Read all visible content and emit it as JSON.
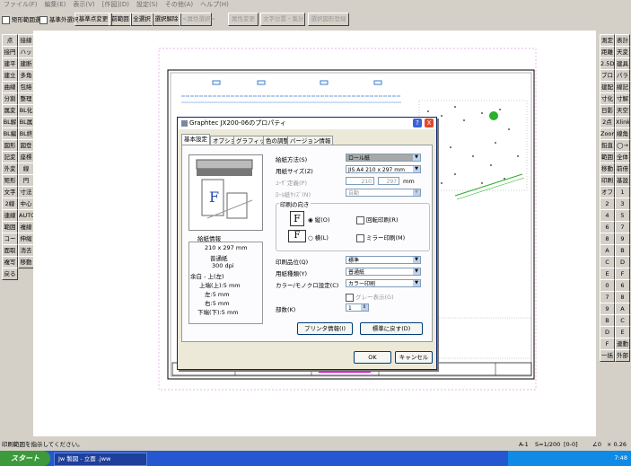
{
  "menu": [
    "ファイル(F)",
    "編集(E)",
    "表示(V)",
    "[作図](D)",
    "設定(S)",
    "その他(A)",
    "ヘルプ(H)"
  ],
  "toolbar": {
    "chk_rect": "矩形範囲選択",
    "chk_outside": "基準外選択",
    "btn_enclose": "基準点変更",
    "btn_prev": "前範囲",
    "btn_all": "全選択",
    "btn_cancel": "選択解除",
    "btn_multi": "<属性選択>",
    "btn_attr": "属性変更",
    "btn_layer": "文字位置・集計",
    "btn_addline": "選択図形登録"
  },
  "left_tools": [
    "点",
    "接線",
    "接円",
    "ハッチ",
    "建平",
    "建断",
    "建立",
    "多角形",
    "曲線",
    "包絡",
    "分割",
    "整理",
    "属変",
    "BL化",
    "BL解",
    "BL属",
    "BL編",
    "BL終",
    "図形",
    "図登",
    "記変",
    "座標",
    "外変",
    "線",
    "矩形",
    "円",
    "文字",
    "寸法",
    "2線",
    "中心線",
    "連線",
    "AUTO",
    "範囲",
    "複線",
    "コーナー",
    "伸縮",
    "面取",
    "消去",
    "複写",
    "移動",
    "戻る"
  ],
  "right_tools": [
    "測定",
    "表計",
    "距離",
    "天変",
    "2.5D",
    "建具",
    "ブロック",
    "パラメ",
    "建配",
    "線記変",
    "寸化",
    "寸解",
    "日影",
    "天空",
    "2点角",
    "Xlink",
    "Zoom",
    "線角",
    "鉛直",
    "◯→",
    "範囲",
    "全体",
    "移動",
    "前倍",
    "印刷",
    "基設",
    "オフセット",
    "1",
    "2",
    "3",
    "4",
    "5",
    "6",
    "7",
    "8",
    "9",
    "A",
    "B",
    "C",
    "D",
    "E",
    "F",
    "0",
    "6",
    "7",
    "8",
    "9",
    "A",
    "B",
    "C",
    "D",
    "E",
    "F",
    "連動",
    "一括",
    "外部",
    "取込",
    "戻る"
  ],
  "dialog": {
    "title": "Graphtec JX200-06のプロパティ",
    "help": "?",
    "close": "X",
    "tabs": [
      "基本設定",
      "オプション",
      "グラフィックス",
      "色の調整",
      "バージョン情報"
    ],
    "preview": {
      "section": "給紙情報",
      "size": "210 x 297 mm",
      "paper": "普通紙",
      "dpi": "300 dpi",
      "margin_label": "余白 - 上(左)",
      "top": "上端(上):5 mm",
      "left": "左:5 mm",
      "right": "右:5 mm",
      "bottom": "下端(下):5 mm"
    },
    "fields": {
      "feed_label": "給紙方法(S)",
      "feed_value": "ロール紙",
      "paper_size_label": "用紙サイズ(Z)",
      "paper_size_value": "JIS A4 210 x 297 mm",
      "custom_label": "ﾕｰｻﾞ定義(P)",
      "custom_w": "210",
      "custom_h": "297",
      "custom_unit": "mm",
      "roll_label": "ﾛｰﾙ紙ｻｲｽﾞ(N)",
      "roll_value": "自動",
      "orient_group": "印刷の向き",
      "portrait": "縦(O)",
      "landscape": "横(L)",
      "rotate": "回転印刷(R)",
      "mirror": "ミラー印刷(M)",
      "quality_label": "印刷品位(Q)",
      "quality_value": "標準",
      "media_label": "用紙種類(Y)",
      "media_value": "普通紙",
      "color_label": "カラー/モノクロ設定(C)",
      "color_value": "カラー印刷",
      "gray_label": "グレー表示(G)",
      "copies_label": "部数(K)",
      "copies_value": "1"
    },
    "buttons": {
      "printer_info": "プリンタ情報(I)",
      "restore": "標準に戻す(D)",
      "ok": "OK",
      "cancel": "キャンセル"
    }
  },
  "status": {
    "message": "印刷範囲を指示してください。",
    "a": "A-1",
    "scale": "S=1/200",
    "layer": "[0-0]",
    "angle": "∠0",
    "zoom": "× 0.26"
  },
  "taskbar": {
    "start": "スタート",
    "task": "Jw 製図 - 立面 .jww",
    "clock": "7:48"
  }
}
